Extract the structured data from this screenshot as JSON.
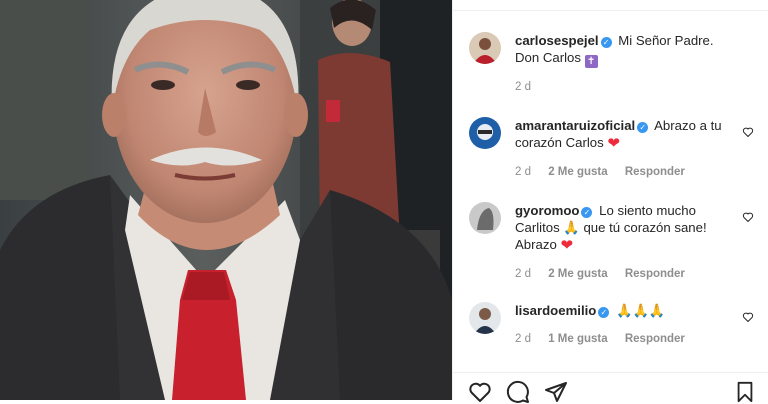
{
  "post": {
    "author": "carlosespejel",
    "caption": "Mi Señor Padre. Don Carlos",
    "caption_emoji": "✝",
    "time": "2 d"
  },
  "comments": [
    {
      "user": "amarantaruizoficial",
      "text": "Abrazo a tu corazón Carlos",
      "emoji": "❤",
      "time": "2 d",
      "likes": "2 Me gusta",
      "reply": "Responder"
    },
    {
      "user": "gyoromoo",
      "text_a": "Lo siento mucho Carlitos",
      "emoji_a": "🙏",
      "text_b": "que tú corazón sane! Abrazo",
      "emoji_b": "❤",
      "time": "2 d",
      "likes": "2 Me gusta",
      "reply": "Responder"
    },
    {
      "user": "lisardoemilio",
      "emoji_text": "🙏🙏🙏",
      "time": "2 d",
      "likes": "1 Me gusta",
      "reply": "Responder"
    }
  ],
  "icons": {
    "like": "heart-outline-icon",
    "comment": "comment-bubble-icon",
    "share": "paper-plane-icon",
    "save": "bookmark-icon",
    "verified": "verified-badge-icon"
  },
  "colors": {
    "verified": "#3897f0",
    "secondary_text": "#8e8e8e",
    "heart_red": "#ed2b3a"
  }
}
